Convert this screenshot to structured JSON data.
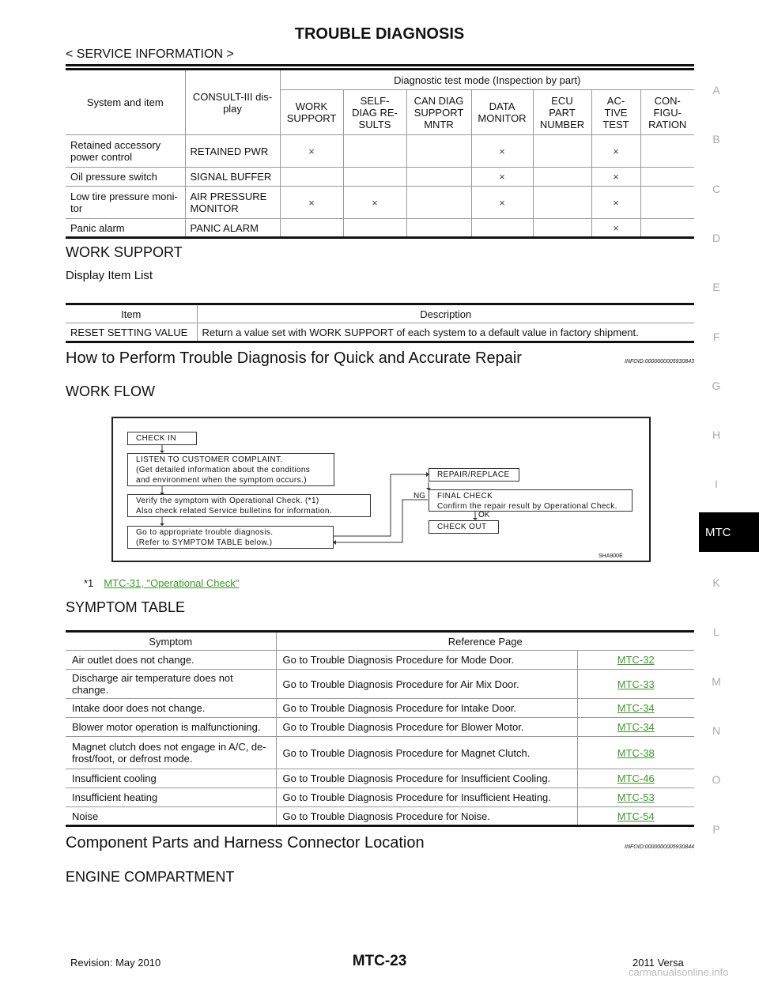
{
  "header": {
    "title": "TROUBLE DIAGNOSIS",
    "section": "< SERVICE INFORMATION >"
  },
  "side_index": [
    "A",
    "B",
    "C",
    "D",
    "E",
    "F",
    "G",
    "H",
    "I",
    "MTC",
    "K",
    "L",
    "M",
    "N",
    "O",
    "P"
  ],
  "consult_table": {
    "col_system": "System and item",
    "col_display": "CONSULT-III dis-play",
    "group": "Diagnostic test mode (Inspection by part)",
    "modes": [
      "WORK SUPPORT",
      "SELF-DIAG RE-SULTS",
      "CAN DIAG SUPPORT MNTR",
      "DATA MONITOR",
      "ECU PART NUMBER",
      "AC-TIVE TEST",
      "CON-FIGU-RATION"
    ],
    "rows": [
      {
        "system": "Retained accessory power control",
        "display": "RETAINED PWR",
        "marks": [
          "×",
          "",
          "",
          "×",
          "",
          "×",
          ""
        ]
      },
      {
        "system": "Oil pressure switch",
        "display": "SIGNAL BUFFER",
        "marks": [
          "",
          "",
          "",
          "×",
          "",
          "×",
          ""
        ]
      },
      {
        "system": "Low tire pressure moni-tor",
        "display": "AIR PRESSURE MONITOR",
        "marks": [
          "×",
          "×",
          "",
          "×",
          "",
          "×",
          ""
        ]
      },
      {
        "system": "Panic alarm",
        "display": "PANIC ALARM",
        "marks": [
          "",
          "",
          "",
          "",
          "",
          "×",
          ""
        ]
      }
    ]
  },
  "work_support": {
    "heading": "WORK SUPPORT",
    "subheading": "Display Item List",
    "col_item": "Item",
    "col_desc": "Description",
    "rows": [
      {
        "item": "RESET SETTING VALUE",
        "desc": "Return a value set with WORK SUPPORT of each system to a default value in factory shipment."
      }
    ]
  },
  "quick": {
    "heading": "How to Perform Trouble Diagnosis for Quick and Accurate Repair",
    "infoid": "INFOID:0000000005930843",
    "sub": "WORK FLOW"
  },
  "flow": {
    "check_in": "CHECK IN",
    "listen": [
      "LISTEN TO CUSTOMER COMPLAINT.",
      "(Get detailed information about the conditions",
      "and environment when the symptom occurs.)"
    ],
    "verify": [
      "Verify the symptom with Operational Check. (*1)",
      "Also check related Service bulletins for information."
    ],
    "goto": [
      "Go to appropriate trouble diagnosis.",
      "(Refer to SYMPTOM TABLE below.)"
    ],
    "repair": "REPAIR/REPLACE",
    "final": [
      "FINAL CHECK",
      "Confirm the repair result by Operational Check."
    ],
    "ng": "NG",
    "ok": "OK",
    "check_out": "CHECK OUT",
    "fig_id": "SHA900E"
  },
  "footnote": {
    "mark": "*1",
    "link": "MTC-31, \"Operational Check\""
  },
  "symptom": {
    "heading": "SYMPTOM TABLE",
    "col_symptom": "Symptom",
    "col_ref": "Reference Page",
    "rows": [
      {
        "s": "Air outlet does not change.",
        "r": "Go to Trouble Diagnosis Procedure for Mode Door.",
        "p": "MTC-32"
      },
      {
        "s": "Discharge air temperature does not change.",
        "r": "Go to Trouble Diagnosis Procedure for Air Mix Door.",
        "p": "MTC-33"
      },
      {
        "s": "Intake door does not change.",
        "r": "Go to Trouble Diagnosis Procedure for Intake Door.",
        "p": "MTC-34"
      },
      {
        "s": "Blower motor operation is malfunctioning.",
        "r": "Go to Trouble Diagnosis Procedure for Blower Motor.",
        "p": "MTC-34"
      },
      {
        "s": "Magnet clutch does not engage in A/C, de-frost/foot, or defrost mode.",
        "r": "Go to Trouble Diagnosis Procedure for Magnet Clutch.",
        "p": "MTC-38"
      },
      {
        "s": "Insufficient cooling",
        "r": "Go to Trouble Diagnosis Procedure for Insufficient Cooling.",
        "p": "MTC-46"
      },
      {
        "s": "Insufficient heating",
        "r": "Go to Trouble Diagnosis Procedure for Insufficient Heating.",
        "p": "MTC-53"
      },
      {
        "s": "Noise",
        "r": "Go to Trouble Diagnosis Procedure for Noise.",
        "p": "MTC-54"
      }
    ]
  },
  "component": {
    "heading": "Component Parts and Harness Connector Location",
    "infoid": "INFOID:0000000005930844",
    "sub": "ENGINE COMPARTMENT"
  },
  "footer": {
    "revision": "Revision: May 2010",
    "page": "MTC-23",
    "model": "2011 Versa",
    "watermark": "carmanualsonline.info"
  },
  "colors": {
    "link": "#3a9a2a",
    "tab": "#000000"
  }
}
